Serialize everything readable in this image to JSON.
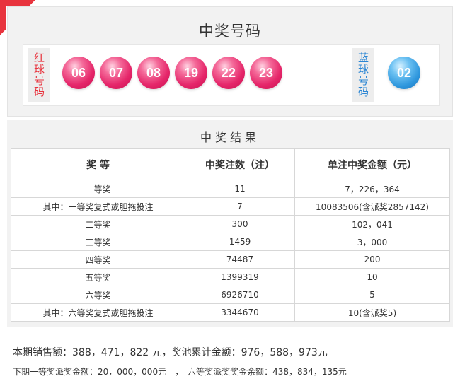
{
  "draw": {
    "section_title": "中奖号码",
    "red_label": "红球号码",
    "blue_label": "蓝球号码",
    "red_balls": [
      "06",
      "07",
      "08",
      "19",
      "22",
      "23"
    ],
    "blue_balls": [
      "02"
    ],
    "colors": {
      "red_ball": "#e5266a",
      "blue_ball": "#2f97dd",
      "red_label": "#e8343e",
      "blue_label": "#2b86d4"
    }
  },
  "results": {
    "title": "中奖结果",
    "headers": [
      "奖 等",
      "中奖注数（注）",
      "单注中奖金额（元）"
    ],
    "rows": [
      [
        "一等奖",
        "11",
        "7，226，364"
      ],
      [
        "其中：一等奖复式或胆拖投注",
        "7",
        "10083506(含派奖2857142)"
      ],
      [
        "二等奖",
        "300",
        "102，041"
      ],
      [
        "三等奖",
        "1459",
        "3，000"
      ],
      [
        "四等奖",
        "74487",
        "200"
      ],
      [
        "五等奖",
        "1399319",
        "10"
      ],
      [
        "六等奖",
        "6926710",
        "5"
      ],
      [
        "其中：六等奖复式或胆拖投注",
        "3344670",
        "10(含派奖5)"
      ]
    ]
  },
  "summary": {
    "line1": "本期销售额：388，471，822 元，奖池累计金额：976，588，973元",
    "line2": "下期一等奖派奖金额：20，000，000元　，　六等奖派奖奖金余额：438，834，135元"
  }
}
